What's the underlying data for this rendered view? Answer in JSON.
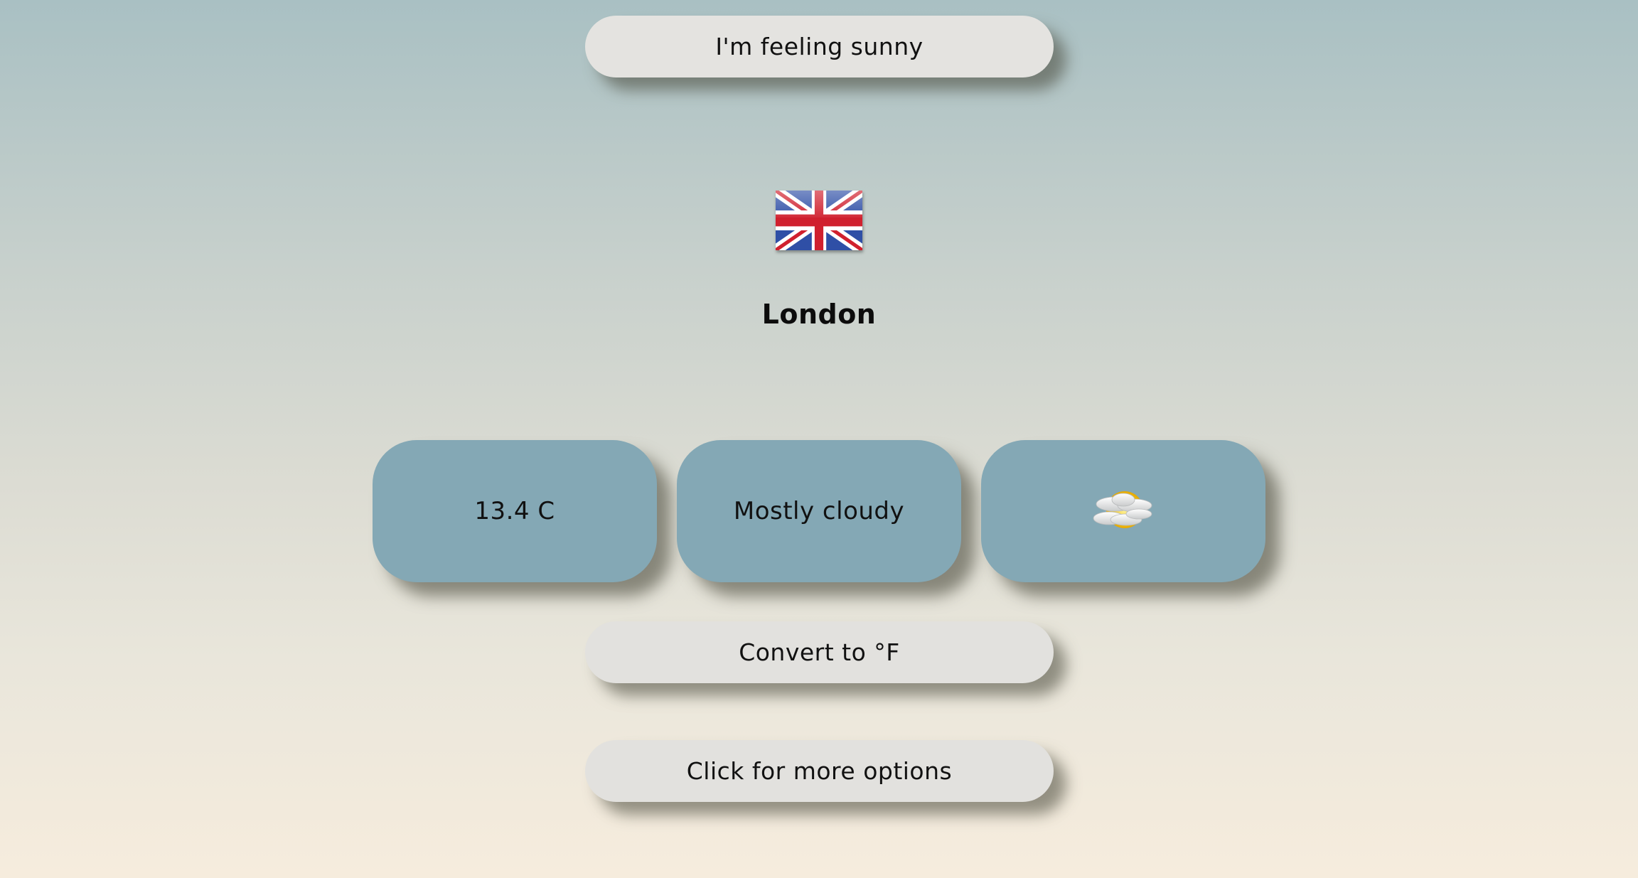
{
  "top_button": {
    "label": "I'm feeling sunny"
  },
  "location": {
    "city": "London",
    "flag_icon": "united-kingdom-flag-icon"
  },
  "cards": {
    "temperature": "13.4 C",
    "condition": "Mostly cloudy",
    "icon": "partly-cloudy-sun-icon"
  },
  "convert_button": {
    "label": "Convert to °F"
  },
  "options_button": {
    "label": "Click for more options"
  },
  "colors": {
    "card_background": "#84a8b5",
    "button_background": "#e4e3e0",
    "flag_blue": "#2f4fa6",
    "flag_red": "#d0202e"
  }
}
